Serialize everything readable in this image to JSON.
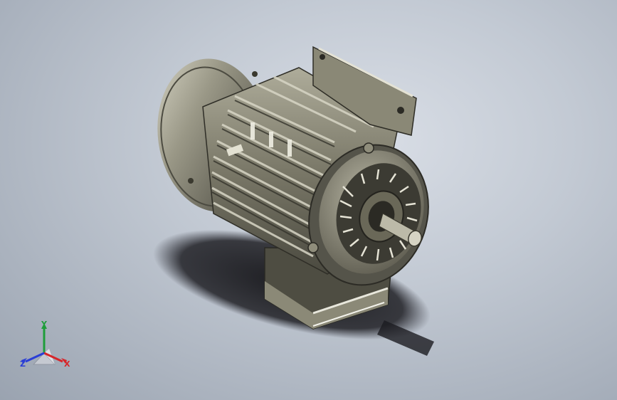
{
  "viewport": {
    "background_top": "#d9dee6",
    "background_bottom": "#9aa3b0"
  },
  "model": {
    "name": "electric-motor",
    "body_color": "#6f6c5e",
    "highlight_color": "#b9b6a4",
    "shadow_color": "#1f1f24"
  },
  "triad": {
    "y_label": "Y",
    "x_label": "X",
    "z_label": "Z",
    "y_color": "#1f9d3a",
    "x_color": "#d6262a",
    "z_color": "#2a3ed6"
  }
}
